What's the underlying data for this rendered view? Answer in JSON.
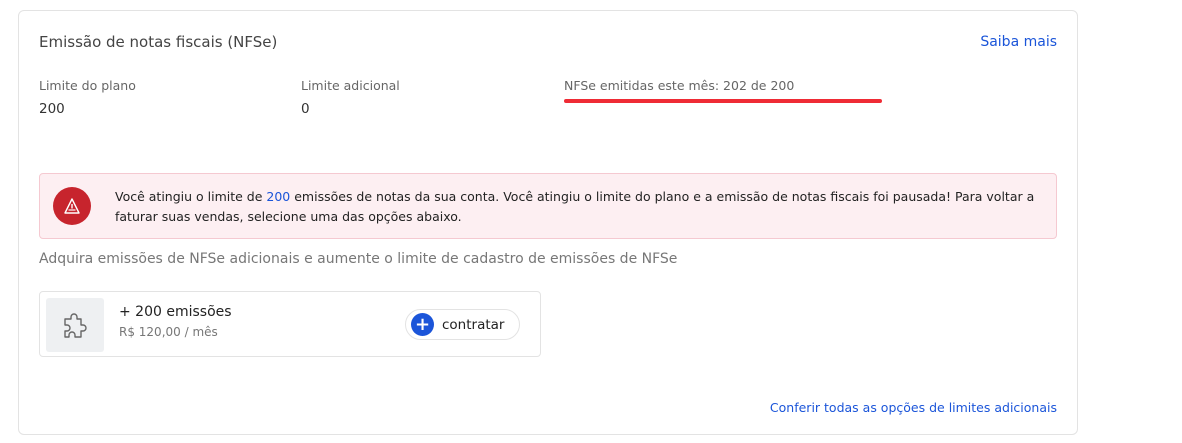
{
  "card": {
    "title": "Emissão de notas fiscais (NFSe)",
    "saiba_mais": "Saiba mais"
  },
  "stats": {
    "plan_limit_label": "Limite do plano",
    "plan_limit_value": "200",
    "additional_limit_label": "Limite adicional",
    "additional_limit_value": "0",
    "emitted_label": "NFSe emitidas este mês: 202 de 200"
  },
  "alert": {
    "text_before": "Você atingiu o limite de ",
    "highlight": "200",
    "text_after": " emissões de notas da sua conta. Você atingiu o limite do plano e a emissão de notas fiscais foi pausada! Para voltar a faturar suas vendas, selecione uma das opções abaixo.",
    "color": "#c7242d"
  },
  "offer": {
    "subtitle": "Adquira emissões de NFSe adicionais e aumente o limite de cadastro de emissões de NFSe",
    "product_name": "+ 200 emissões",
    "product_price": "R$ 120,00 / mês",
    "icon": "puzzle-icon",
    "button_label": "contratar"
  },
  "footer": {
    "link": "Conferir todas as opções de limites adicionais"
  },
  "colors": {
    "accent": "#1b55d9",
    "error": "#ef2b35"
  }
}
